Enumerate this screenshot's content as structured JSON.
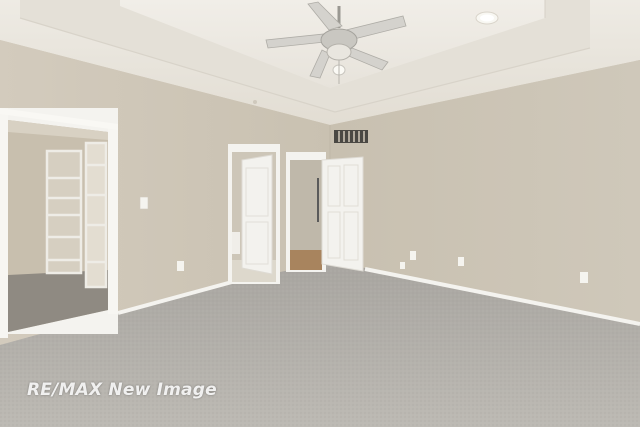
{
  "photo": {
    "subject": "empty-bedroom",
    "watermark": "RE/MAX New Image",
    "colors": {
      "wall_left": "#cdc5b6",
      "wall_right": "#cbc3b3",
      "ceiling": "#ebe7df",
      "carpet": "#b4b1ab",
      "trim": "#f6f5f1",
      "door": "#f3f2ee"
    }
  }
}
